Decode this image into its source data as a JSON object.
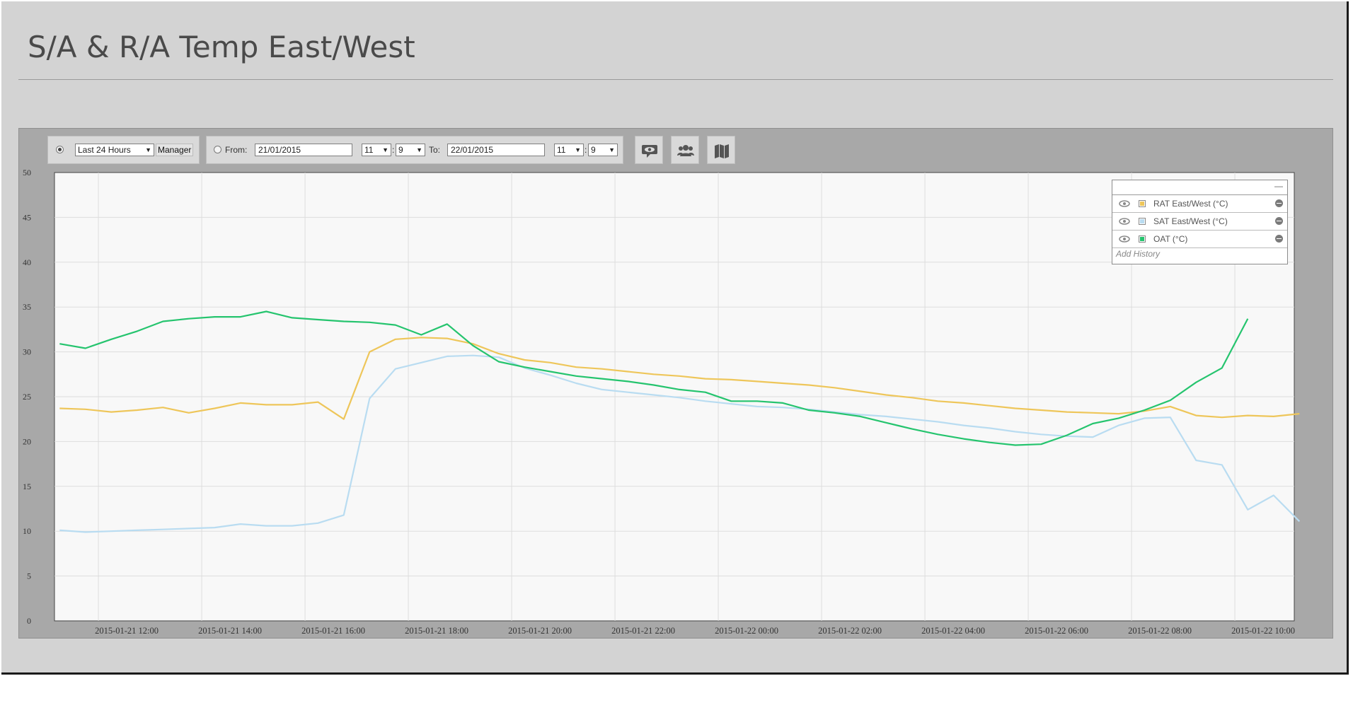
{
  "page": {
    "title": "S/A & R/A Temp East/West"
  },
  "controls": {
    "period_select": "Last 24 Hours",
    "manager_button": "Manager",
    "from_label": "From:",
    "from_date": "21/01/2015",
    "from_hour": "11",
    "from_minute": "9",
    "to_label": "To:",
    "to_date": "22/01/2015",
    "to_hour": "11",
    "to_minute": "9",
    "time_separator": ":",
    "icons": [
      "comment-eye-icon",
      "users-icon",
      "map-icon"
    ]
  },
  "legend": {
    "minimize": "—",
    "items": [
      {
        "label": "RAT East/West (°C)",
        "color": "#eec65a"
      },
      {
        "label": "SAT East/West (°C)",
        "color": "#b9dcf1"
      },
      {
        "label": "OAT (°C)",
        "color": "#25c46e"
      }
    ],
    "add_history": "Add History"
  },
  "chart_data": {
    "type": "line",
    "ylim": [
      0,
      50
    ],
    "yticks": [
      0,
      5,
      10,
      15,
      20,
      25,
      30,
      35,
      40,
      45,
      50
    ],
    "x_ticks": [
      "2015-01-21 12:00",
      "2015-01-21 14:00",
      "2015-01-21 16:00",
      "2015-01-21 18:00",
      "2015-01-21 20:00",
      "2015-01-21 22:00",
      "2015-01-22 00:00",
      "2015-01-22 02:00",
      "2015-01-22 04:00",
      "2015-01-22 06:00",
      "2015-01-22 08:00",
      "2015-01-22 10:00"
    ],
    "xlim": [
      "2015-01-21 11:09",
      "2015-01-22 11:09"
    ],
    "grid": true,
    "legend_position": "top-right",
    "series": [
      {
        "name": "RAT East/West (°C)",
        "color": "#eec65a",
        "points": [
          [
            "2015-01-21 11:15",
            23.7
          ],
          [
            "2015-01-21 11:45",
            23.6
          ],
          [
            "2015-01-21 12:15",
            23.3
          ],
          [
            "2015-01-21 12:45",
            23.5
          ],
          [
            "2015-01-21 13:15",
            23.8
          ],
          [
            "2015-01-21 13:45",
            23.2
          ],
          [
            "2015-01-21 14:15",
            23.7
          ],
          [
            "2015-01-21 14:45",
            24.3
          ],
          [
            "2015-01-21 15:15",
            24.1
          ],
          [
            "2015-01-21 15:45",
            24.1
          ],
          [
            "2015-01-21 16:15",
            24.4
          ],
          [
            "2015-01-21 16:45",
            22.5
          ],
          [
            "2015-01-21 17:15",
            30.0
          ],
          [
            "2015-01-21 17:45",
            31.4
          ],
          [
            "2015-01-21 18:15",
            31.6
          ],
          [
            "2015-01-21 18:45",
            31.5
          ],
          [
            "2015-01-21 19:15",
            30.9
          ],
          [
            "2015-01-21 19:45",
            29.8
          ],
          [
            "2015-01-21 20:15",
            29.1
          ],
          [
            "2015-01-21 20:45",
            28.8
          ],
          [
            "2015-01-21 21:15",
            28.3
          ],
          [
            "2015-01-21 21:45",
            28.1
          ],
          [
            "2015-01-21 22:15",
            27.8
          ],
          [
            "2015-01-21 22:45",
            27.5
          ],
          [
            "2015-01-21 23:15",
            27.3
          ],
          [
            "2015-01-21 23:45",
            27.0
          ],
          [
            "2015-01-22 00:15",
            26.9
          ],
          [
            "2015-01-22 00:45",
            26.7
          ],
          [
            "2015-01-22 01:15",
            26.5
          ],
          [
            "2015-01-22 01:45",
            26.3
          ],
          [
            "2015-01-22 02:15",
            26.0
          ],
          [
            "2015-01-22 02:45",
            25.6
          ],
          [
            "2015-01-22 03:15",
            25.2
          ],
          [
            "2015-01-22 03:45",
            24.9
          ],
          [
            "2015-01-22 04:15",
            24.5
          ],
          [
            "2015-01-22 04:45",
            24.3
          ],
          [
            "2015-01-22 05:15",
            24.0
          ],
          [
            "2015-01-22 05:45",
            23.7
          ],
          [
            "2015-01-22 06:15",
            23.5
          ],
          [
            "2015-01-22 06:45",
            23.3
          ],
          [
            "2015-01-22 07:15",
            23.2
          ],
          [
            "2015-01-22 07:45",
            23.1
          ],
          [
            "2015-01-22 08:15",
            23.4
          ],
          [
            "2015-01-22 08:45",
            23.9
          ],
          [
            "2015-01-22 09:15",
            22.9
          ],
          [
            "2015-01-22 09:45",
            22.7
          ],
          [
            "2015-01-22 10:15",
            22.9
          ],
          [
            "2015-01-22 10:45",
            22.8
          ],
          [
            "2015-01-22 11:15",
            23.1
          ]
        ]
      },
      {
        "name": "SAT East/West (°C)",
        "color": "#b9dcf1",
        "points": [
          [
            "2015-01-21 11:15",
            10.1
          ],
          [
            "2015-01-21 11:45",
            9.9
          ],
          [
            "2015-01-21 12:15",
            10.0
          ],
          [
            "2015-01-21 12:45",
            10.1
          ],
          [
            "2015-01-21 13:15",
            10.2
          ],
          [
            "2015-01-21 13:45",
            10.3
          ],
          [
            "2015-01-21 14:15",
            10.4
          ],
          [
            "2015-01-21 14:45",
            10.8
          ],
          [
            "2015-01-21 15:15",
            10.6
          ],
          [
            "2015-01-21 15:45",
            10.6
          ],
          [
            "2015-01-21 16:15",
            10.9
          ],
          [
            "2015-01-21 16:45",
            11.8
          ],
          [
            "2015-01-21 17:15",
            24.8
          ],
          [
            "2015-01-21 17:45",
            28.1
          ],
          [
            "2015-01-21 18:15",
            28.8
          ],
          [
            "2015-01-21 18:45",
            29.5
          ],
          [
            "2015-01-21 19:15",
            29.6
          ],
          [
            "2015-01-21 19:45",
            29.4
          ],
          [
            "2015-01-21 20:15",
            28.2
          ],
          [
            "2015-01-21 20:45",
            27.4
          ],
          [
            "2015-01-21 21:15",
            26.5
          ],
          [
            "2015-01-21 21:45",
            25.8
          ],
          [
            "2015-01-21 22:15",
            25.5
          ],
          [
            "2015-01-21 22:45",
            25.2
          ],
          [
            "2015-01-21 23:15",
            24.9
          ],
          [
            "2015-01-21 23:45",
            24.5
          ],
          [
            "2015-01-22 00:15",
            24.2
          ],
          [
            "2015-01-22 00:45",
            23.9
          ],
          [
            "2015-01-22 01:15",
            23.8
          ],
          [
            "2015-01-22 01:45",
            23.6
          ],
          [
            "2015-01-22 02:15",
            23.3
          ],
          [
            "2015-01-22 02:45",
            23.0
          ],
          [
            "2015-01-22 03:15",
            22.8
          ],
          [
            "2015-01-22 03:45",
            22.5
          ],
          [
            "2015-01-22 04:15",
            22.2
          ],
          [
            "2015-01-22 04:45",
            21.8
          ],
          [
            "2015-01-22 05:15",
            21.5
          ],
          [
            "2015-01-22 05:45",
            21.1
          ],
          [
            "2015-01-22 06:15",
            20.8
          ],
          [
            "2015-01-22 06:45",
            20.6
          ],
          [
            "2015-01-22 07:15",
            20.5
          ],
          [
            "2015-01-22 07:45",
            21.8
          ],
          [
            "2015-01-22 08:15",
            22.6
          ],
          [
            "2015-01-22 08:45",
            22.7
          ],
          [
            "2015-01-22 09:15",
            17.9
          ],
          [
            "2015-01-22 09:45",
            17.4
          ],
          [
            "2015-01-22 10:15",
            12.4
          ],
          [
            "2015-01-22 10:45",
            14.0
          ],
          [
            "2015-01-22 11:15",
            11.1
          ]
        ]
      },
      {
        "name": "OAT (°C)",
        "color": "#25c46e",
        "points": [
          [
            "2015-01-21 11:15",
            30.9
          ],
          [
            "2015-01-21 11:45",
            30.4
          ],
          [
            "2015-01-21 12:15",
            31.4
          ],
          [
            "2015-01-21 12:45",
            32.3
          ],
          [
            "2015-01-21 13:15",
            33.4
          ],
          [
            "2015-01-21 13:45",
            33.7
          ],
          [
            "2015-01-21 14:15",
            33.9
          ],
          [
            "2015-01-21 14:45",
            33.9
          ],
          [
            "2015-01-21 15:15",
            34.5
          ],
          [
            "2015-01-21 15:45",
            33.8
          ],
          [
            "2015-01-21 16:15",
            33.6
          ],
          [
            "2015-01-21 16:45",
            33.4
          ],
          [
            "2015-01-21 17:15",
            33.3
          ],
          [
            "2015-01-21 17:45",
            33.0
          ],
          [
            "2015-01-21 18:15",
            31.9
          ],
          [
            "2015-01-21 18:45",
            33.1
          ],
          [
            "2015-01-21 19:15",
            30.7
          ],
          [
            "2015-01-21 19:45",
            28.9
          ],
          [
            "2015-01-21 20:15",
            28.3
          ],
          [
            "2015-01-21 20:45",
            27.8
          ],
          [
            "2015-01-21 21:15",
            27.3
          ],
          [
            "2015-01-21 21:45",
            27.0
          ],
          [
            "2015-01-21 22:15",
            26.7
          ],
          [
            "2015-01-21 22:45",
            26.3
          ],
          [
            "2015-01-21 23:15",
            25.8
          ],
          [
            "2015-01-21 23:45",
            25.5
          ],
          [
            "2015-01-22 00:15",
            24.5
          ],
          [
            "2015-01-22 00:45",
            24.5
          ],
          [
            "2015-01-22 01:15",
            24.3
          ],
          [
            "2015-01-22 01:45",
            23.5
          ],
          [
            "2015-01-22 02:15",
            23.2
          ],
          [
            "2015-01-22 02:45",
            22.8
          ],
          [
            "2015-01-22 03:15",
            22.1
          ],
          [
            "2015-01-22 03:45",
            21.4
          ],
          [
            "2015-01-22 04:15",
            20.8
          ],
          [
            "2015-01-22 04:45",
            20.3
          ],
          [
            "2015-01-22 05:15",
            19.9
          ],
          [
            "2015-01-22 05:45",
            19.6
          ],
          [
            "2015-01-22 06:15",
            19.7
          ],
          [
            "2015-01-22 06:45",
            20.7
          ],
          [
            "2015-01-22 07:15",
            22.0
          ],
          [
            "2015-01-22 07:45",
            22.6
          ],
          [
            "2015-01-22 08:15",
            23.5
          ],
          [
            "2015-01-22 08:45",
            24.6
          ],
          [
            "2015-01-22 09:15",
            26.6
          ],
          [
            "2015-01-22 09:45",
            28.2
          ],
          [
            "2015-01-22 10:15",
            33.7
          ]
        ]
      }
    ]
  }
}
